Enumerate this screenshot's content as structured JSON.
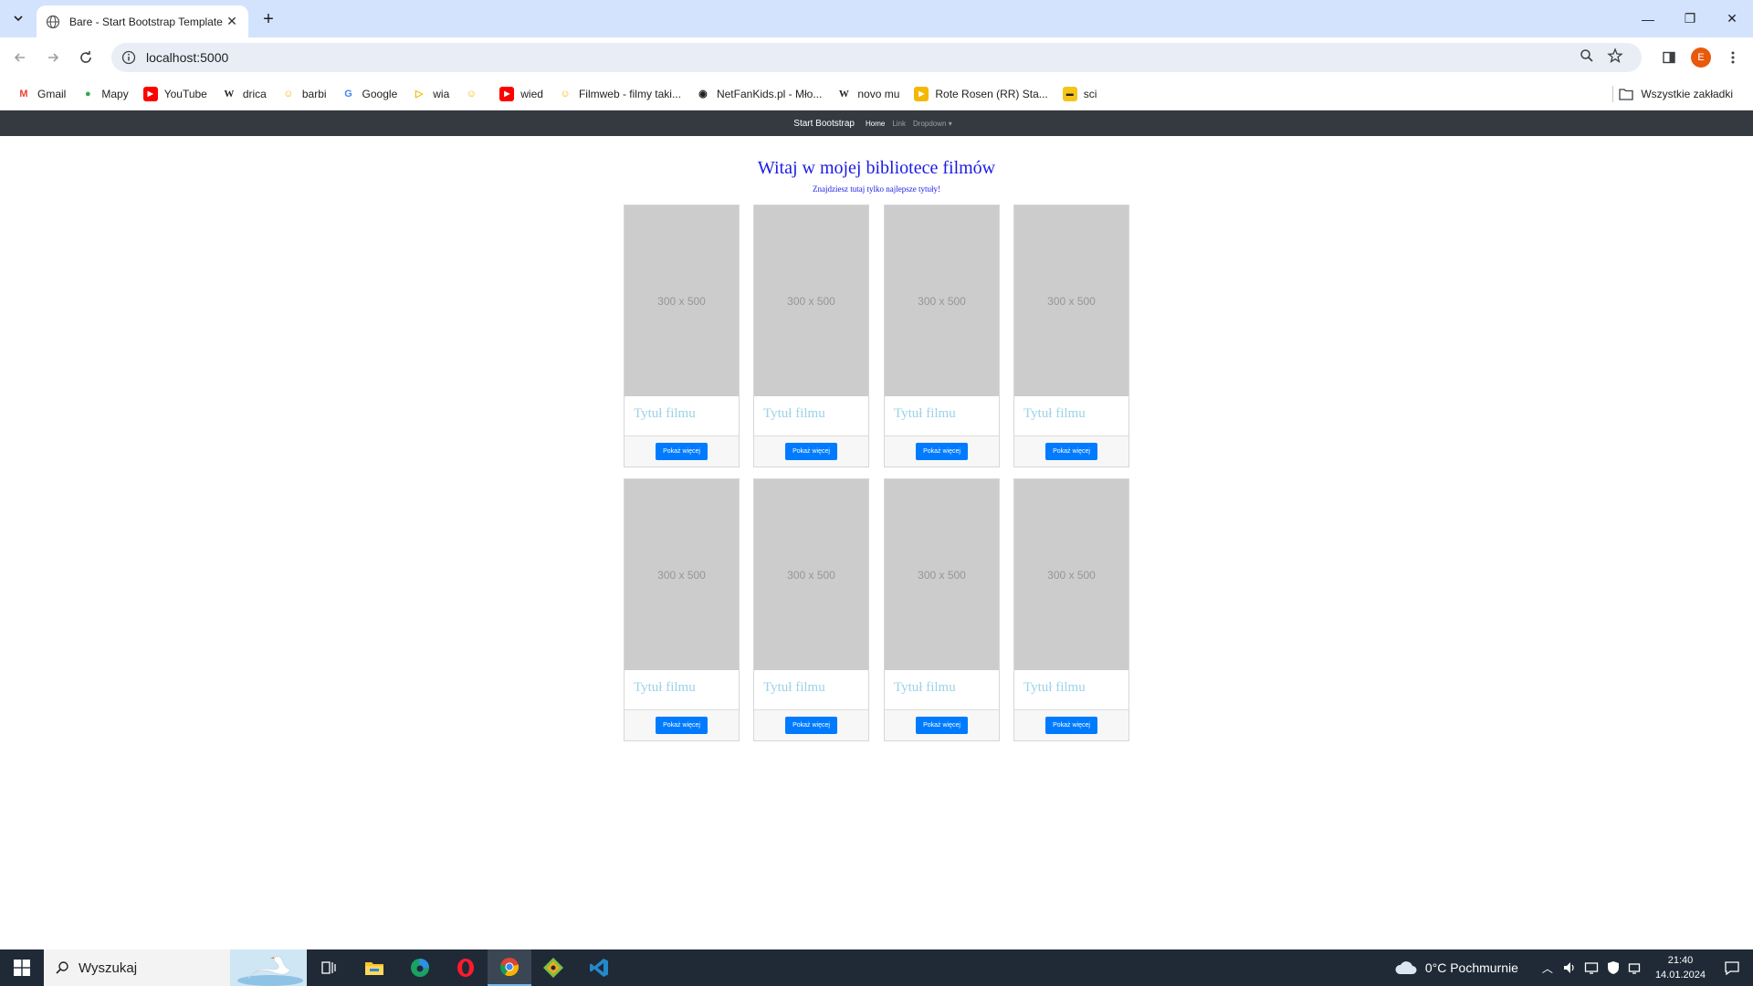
{
  "browser": {
    "tab_title": "Bare - Start Bootstrap Template",
    "url": "localhost:5000",
    "profile_initial": "E",
    "bookmarks": [
      {
        "label": "Gmail",
        "icon": "gmail-icon"
      },
      {
        "label": "Mapy",
        "icon": "maps-icon"
      },
      {
        "label": "YouTube",
        "icon": "youtube-icon"
      },
      {
        "label": "drica",
        "icon": "wikipedia-icon"
      },
      {
        "label": "barbi",
        "icon": "filmweb-icon"
      },
      {
        "label": "Google",
        "icon": "google-icon"
      },
      {
        "label": "wia",
        "icon": "label-icon"
      },
      {
        "label": "",
        "icon": "filmweb-icon"
      },
      {
        "label": "wied",
        "icon": "youtube-icon"
      },
      {
        "label": "Filmweb - filmy taki...",
        "icon": "filmweb-icon"
      },
      {
        "label": "NetFanKids.pl - Mło...",
        "icon": "netfan-icon"
      },
      {
        "label": "novo mu",
        "icon": "wikipedia-icon"
      },
      {
        "label": "Rote Rosen (RR) Sta...",
        "icon": "play-icon"
      },
      {
        "label": "sci",
        "icon": "imdb-icon"
      }
    ],
    "all_bookmarks_label": "Wszystkie zakładki"
  },
  "site": {
    "brand": "Start Bootstrap",
    "nav": [
      {
        "label": "Home",
        "active": true
      },
      {
        "label": "Link",
        "active": false
      },
      {
        "label": "Dropdown ▾",
        "active": false
      }
    ],
    "title": "Witaj w mojej bibliotece filmów",
    "subtitle": "Znajdziesz tutaj tylko najlepsze tytuły!",
    "cards": [
      {
        "image_text": "300 x 500",
        "title": "Tytuł filmu",
        "button": "Pokaż więcej"
      },
      {
        "image_text": "300 x 500",
        "title": "Tytuł filmu",
        "button": "Pokaż więcej"
      },
      {
        "image_text": "300 x 500",
        "title": "Tytuł filmu",
        "button": "Pokaż więcej"
      },
      {
        "image_text": "300 x 500",
        "title": "Tytuł filmu",
        "button": "Pokaż więcej"
      },
      {
        "image_text": "300 x 500",
        "title": "Tytuł filmu",
        "button": "Pokaż więcej"
      },
      {
        "image_text": "300 x 500",
        "title": "Tytuł filmu",
        "button": "Pokaż więcej"
      },
      {
        "image_text": "300 x 500",
        "title": "Tytuł filmu",
        "button": "Pokaż więcej"
      },
      {
        "image_text": "300 x 500",
        "title": "Tytuł filmu",
        "button": "Pokaż więcej"
      }
    ]
  },
  "taskbar": {
    "search_placeholder": "Wyszukaj",
    "weather": "0°C  Pochmurnie",
    "time": "21:40",
    "date": "14.01.2024"
  },
  "colors": {
    "navbar": "#343a40",
    "heading": "#1a1ae6",
    "card_title": "#9ad3e8",
    "button": "#007bff",
    "tabstrip": "#d3e3fd"
  }
}
